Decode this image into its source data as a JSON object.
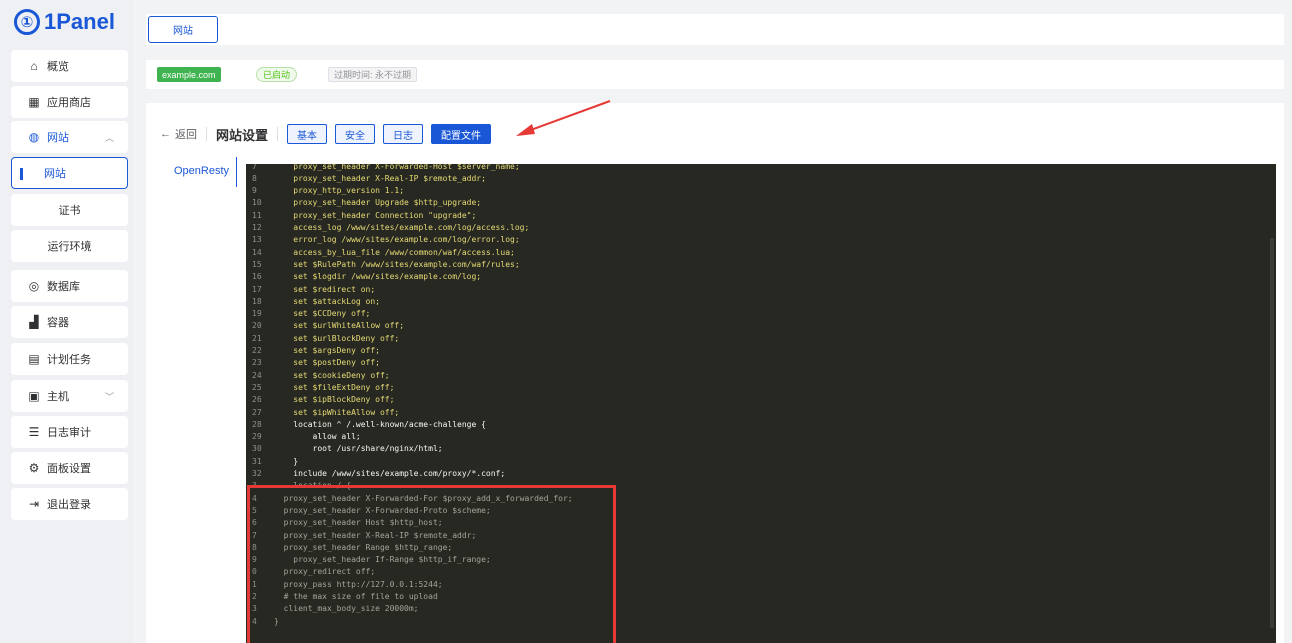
{
  "app": {
    "logo_symbol": "①",
    "logo_text": "1Panel"
  },
  "sidebar": {
    "items": [
      {
        "label": "概览",
        "icon": "home-icon",
        "glyph": "⌂"
      },
      {
        "label": "应用商店",
        "icon": "grid-icon",
        "glyph": "▦"
      },
      {
        "label": "网站",
        "icon": "globe-icon",
        "glyph": "◍",
        "chevron": "︿"
      },
      {
        "label": "网站"
      },
      {
        "label": "证书"
      },
      {
        "label": "运行环境"
      },
      {
        "label": "数据库",
        "icon": "database-icon",
        "glyph": "◎"
      },
      {
        "label": "容器",
        "icon": "docker-icon",
        "glyph": "▟"
      },
      {
        "label": "计划任务",
        "icon": "calendar-icon",
        "glyph": "▤"
      },
      {
        "label": "主机",
        "icon": "host-icon",
        "glyph": "▣",
        "chevron": "﹀"
      },
      {
        "label": "日志审计",
        "icon": "log-icon",
        "glyph": "☰"
      },
      {
        "label": "面板设置",
        "icon": "settings-icon",
        "glyph": "⚙"
      },
      {
        "label": "退出登录",
        "icon": "logout-icon",
        "glyph": "⇥"
      }
    ]
  },
  "tabs": [
    {
      "label": "网站"
    }
  ],
  "site": {
    "domain": "example.com",
    "status": "已启动",
    "expire": "过期时间: 永不过期"
  },
  "toolbar": {
    "back_label": "返回",
    "back_glyph": "←",
    "title": "网站设置",
    "buttons": [
      "基本",
      "安全",
      "日志",
      "配置文件"
    ]
  },
  "side_tab": "OpenResty",
  "editor": {
    "lines": [
      {
        "n": "7",
        "t": "    proxy_set_header X-Forwarded-Host $server_name;",
        "c": ""
      },
      {
        "n": "8",
        "t": "    proxy_set_header X-Real-IP $remote_addr;",
        "c": ""
      },
      {
        "n": "9",
        "t": "    proxy_http_version 1.1;",
        "c": ""
      },
      {
        "n": "10",
        "t": "    proxy_set_header Upgrade $http_upgrade;",
        "c": ""
      },
      {
        "n": "11",
        "t": "    proxy_set_header Connection \"upgrade\";",
        "c": ""
      },
      {
        "n": "12",
        "t": "    access_log /www/sites/example.com/log/access.log;",
        "c": ""
      },
      {
        "n": "13",
        "t": "    error_log /www/sites/example.com/log/error.log;",
        "c": ""
      },
      {
        "n": "14",
        "t": "    access_by_lua_file /www/common/waf/access.lua;",
        "c": ""
      },
      {
        "n": "15",
        "t": "    set $RulePath /www/sites/example.com/waf/rules;",
        "c": ""
      },
      {
        "n": "16",
        "t": "    set $logdir /www/sites/example.com/log;",
        "c": ""
      },
      {
        "n": "17",
        "t": "    set $redirect on;",
        "c": ""
      },
      {
        "n": "18",
        "t": "    set $attackLog on;",
        "c": ""
      },
      {
        "n": "19",
        "t": "    set $CCDeny off;",
        "c": ""
      },
      {
        "n": "20",
        "t": "    set $urlWhiteAllow off;",
        "c": ""
      },
      {
        "n": "21",
        "t": "    set $urlBlockDeny off;",
        "c": ""
      },
      {
        "n": "22",
        "t": "    set $argsDeny off;",
        "c": ""
      },
      {
        "n": "23",
        "t": "    set $postDeny off;",
        "c": ""
      },
      {
        "n": "24",
        "t": "    set $cookieDeny off;",
        "c": ""
      },
      {
        "n": "25",
        "t": "    set $fileExtDeny off;",
        "c": ""
      },
      {
        "n": "26",
        "t": "    set $ipBlockDeny off;",
        "c": ""
      },
      {
        "n": "27",
        "t": "    set $ipWhiteAllow off;",
        "c": ""
      },
      {
        "n": "28",
        "t": "    location ^ /.well-known/acme-challenge {",
        "c": "k"
      },
      {
        "n": "29",
        "t": "        allow all;",
        "c": "k"
      },
      {
        "n": "30",
        "t": "        root /usr/share/nginx/html;",
        "c": "k"
      },
      {
        "n": "31",
        "t": "    }",
        "c": "k"
      },
      {
        "n": "32",
        "t": "    include /www/sites/example.com/proxy/*.conf;",
        "c": "k"
      },
      {
        "n": "3",
        "t": "    location / {",
        "c": "dim"
      },
      {
        "n": "4",
        "t": "  proxy_set_header X-Forwarded-For $proxy_add_x_forwarded_for;",
        "c": "dim"
      },
      {
        "n": "5",
        "t": "  proxy_set_header X-Forwarded-Proto $scheme;",
        "c": "dim"
      },
      {
        "n": "6",
        "t": "  proxy_set_header Host $http_host;",
        "c": "dim"
      },
      {
        "n": "7",
        "t": "  proxy_set_header X-Real-IP $remote_addr;",
        "c": "dim"
      },
      {
        "n": "8",
        "t": "  proxy_set_header Range $http_range;",
        "c": "dim"
      },
      {
        "n": "9",
        "t": "    proxy_set_header If-Range $http_if_range;",
        "c": "dim"
      },
      {
        "n": "0",
        "t": "  proxy_redirect off;",
        "c": "dim"
      },
      {
        "n": "1",
        "t": "  proxy_pass http://127.0.0.1:5244;",
        "c": "dim"
      },
      {
        "n": "2",
        "t": "  # the max size of file to upload",
        "c": "dim"
      },
      {
        "n": "3",
        "t": "  client_max_body_size 20000m;",
        "c": "dim"
      },
      {
        "n": "4",
        "t": "}",
        "c": "dim"
      }
    ]
  },
  "colors": {
    "accent": "#1a57d6",
    "editor_bg": "#272822",
    "highlight": "#e53935"
  }
}
